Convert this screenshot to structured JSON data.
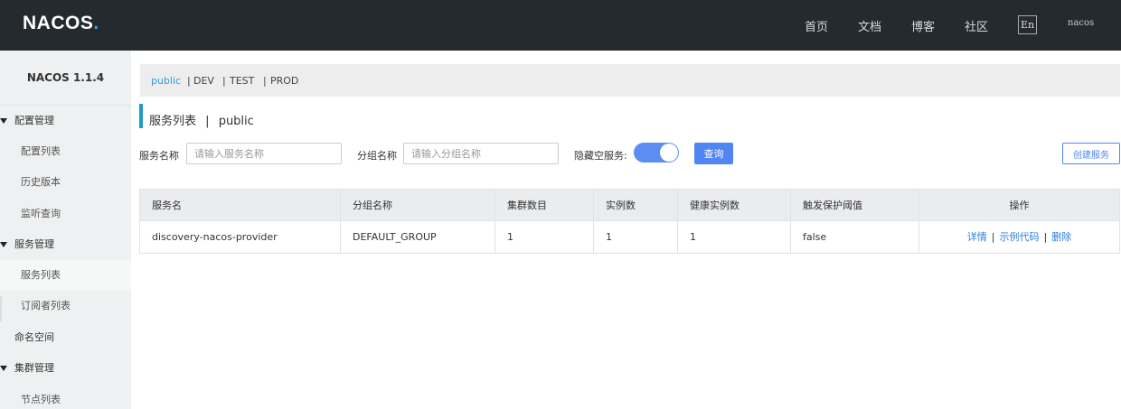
{
  "header": {
    "logo": "NACOS",
    "logo_dot": ".",
    "nav": [
      "首页",
      "文档",
      "博客",
      "社区"
    ],
    "lang": "En",
    "user": "nacos"
  },
  "sidebar": {
    "title": "NACOS 1.1.4",
    "groups": [
      {
        "label": "配置管理",
        "items": [
          "配置列表",
          "历史版本",
          "监听查询"
        ]
      },
      {
        "label": "服务管理",
        "items": [
          "服务列表",
          "订阅者列表"
        ]
      },
      {
        "label": "命名空间"
      },
      {
        "label": "集群管理",
        "items": [
          "节点列表"
        ]
      }
    ],
    "active_item": "服务列表"
  },
  "namespaces": {
    "items": [
      "public",
      "DEV",
      "TEST",
      "PROD"
    ],
    "separator": "|",
    "selected": "public"
  },
  "page": {
    "title": "服务列表",
    "title_sep": "|",
    "namespace": "public"
  },
  "filters": {
    "service_label": "服务名称",
    "service_placeholder": "请输入服务名称",
    "group_label": "分组名称",
    "group_placeholder": "请输入分组名称",
    "hide_empty_label": "隐藏空服务:",
    "hide_empty_on": true,
    "query_button": "查询",
    "create_button": "创建服务"
  },
  "table": {
    "columns": [
      "服务名",
      "分组名称",
      "集群数目",
      "实例数",
      "健康实例数",
      "触发保护阈值",
      "操作"
    ],
    "rows": [
      {
        "service": "discovery-nacos-provider",
        "group": "DEFAULT_GROUP",
        "clusters": "1",
        "instances": "1",
        "healthy": "1",
        "protect": "false",
        "actions": [
          "详情",
          "示例代码",
          "删除"
        ]
      }
    ],
    "action_sep": "|"
  },
  "colors": {
    "header_bg": "#252a2f",
    "accent": "#209bc9",
    "primary": "#4f86f4",
    "link": "#2f7ed8"
  }
}
